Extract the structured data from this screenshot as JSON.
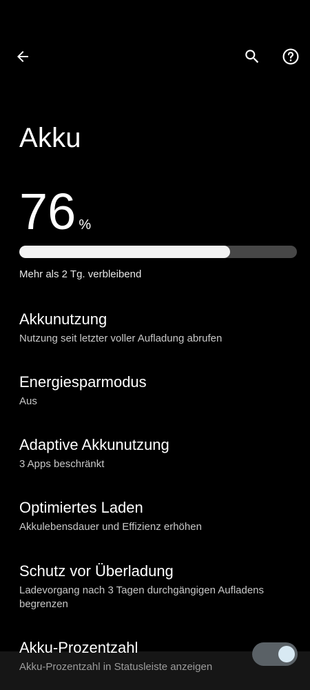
{
  "header": {
    "back_icon": "arrow-left-icon",
    "search_icon": "search-icon",
    "help_icon": "help-circle-icon"
  },
  "page": {
    "title": "Akku"
  },
  "battery": {
    "level": "76",
    "unit": "%",
    "level_fraction": 0.76,
    "remaining": "Mehr als 2 Tg. verbleibend"
  },
  "settings": [
    {
      "title": "Akkunutzung",
      "subtitle": "Nutzung seit letzter voller Aufladung abrufen"
    },
    {
      "title": "Energiesparmodus",
      "subtitle": "Aus"
    },
    {
      "title": "Adaptive Akkunutzung",
      "subtitle": "3 Apps beschränkt"
    },
    {
      "title": "Optimiertes Laden",
      "subtitle": "Akkulebensdauer und Effizienz erhöhen"
    },
    {
      "title": "Schutz vor Überladung",
      "subtitle": "Ladevorgang nach 3 Tagen durchgängigen Aufladens begrenzen"
    },
    {
      "title": "Akku-Prozentzahl",
      "subtitle": "Akku-Prozentzahl in Statusleiste anzeigen",
      "toggle_on": true
    }
  ],
  "colors": {
    "background": "#000000",
    "bar_fill": "#f2f2f2",
    "bar_track": "#474747",
    "toggle_track": "#5a6166",
    "toggle_knob": "#d8e9f3"
  }
}
